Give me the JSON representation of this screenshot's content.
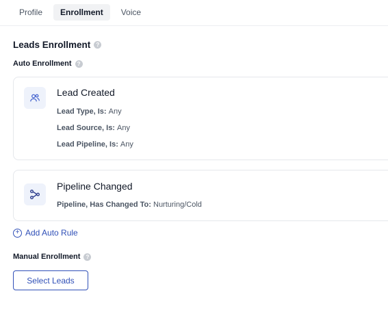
{
  "tabs": [
    {
      "label": "Profile"
    },
    {
      "label": "Enrollment"
    },
    {
      "label": "Voice"
    }
  ],
  "leads_enrollment": {
    "title": "Leads Enrollment"
  },
  "auto_enrollment": {
    "label": "Auto Enrollment"
  },
  "rules": [
    {
      "title": "Lead Created",
      "icon": "users-icon",
      "conditions": [
        {
          "key": "Lead Type, Is:",
          "value": "Any"
        },
        {
          "key": "Lead Source, Is:",
          "value": "Any"
        },
        {
          "key": "Lead Pipeline, Is:",
          "value": "Any"
        }
      ]
    },
    {
      "title": "Pipeline Changed",
      "icon": "pipeline-branch-icon",
      "conditions": [
        {
          "key": "Pipeline, Has Changed To:",
          "value": "Nurturing/Cold"
        }
      ]
    }
  ],
  "add_rule": {
    "label": "Add Auto Rule"
  },
  "manual_enrollment": {
    "label": "Manual Enrollment"
  },
  "select_leads": {
    "label": "Select Leads"
  },
  "colors": {
    "accent": "#2f4fb7",
    "tab_active_bg": "#f1f2f4",
    "border": "#e5e7eb"
  }
}
